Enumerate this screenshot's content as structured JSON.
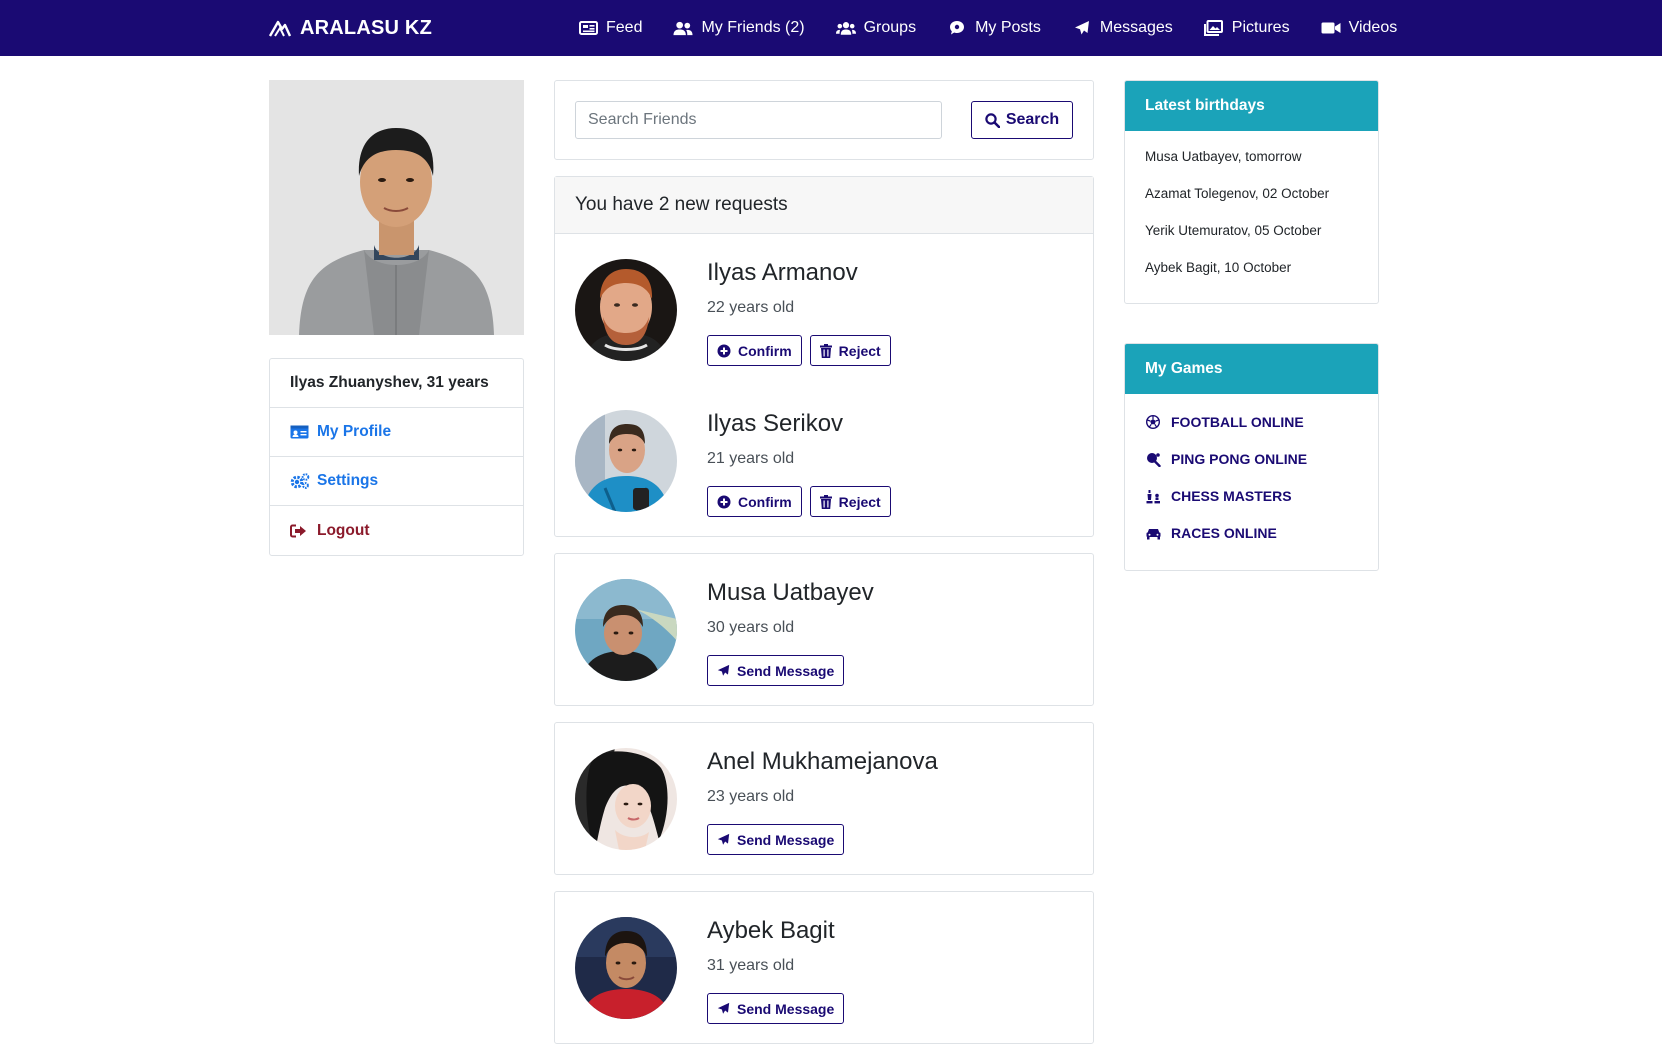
{
  "brand": {
    "name": "ARALASU KZ"
  },
  "nav": [
    {
      "label": "Feed",
      "icon": "newspaper-icon"
    },
    {
      "label": "My Friends (2)",
      "icon": "user-friends-icon"
    },
    {
      "label": "Groups",
      "icon": "users-icon"
    },
    {
      "label": "My Posts",
      "icon": "comment-icon"
    },
    {
      "label": "Messages",
      "icon": "paper-plane-icon"
    },
    {
      "label": "Pictures",
      "icon": "images-icon"
    },
    {
      "label": "Videos",
      "icon": "video-icon"
    }
  ],
  "profile": {
    "name_line": "Ilyas Zhuanyshev, 31 years",
    "links": [
      {
        "label": "My Profile",
        "icon": "id-card-icon"
      },
      {
        "label": "Settings",
        "icon": "cogs-icon"
      },
      {
        "label": "Logout",
        "icon": "sign-out-icon"
      }
    ]
  },
  "search": {
    "placeholder": "Search Friends",
    "value": "",
    "button_label": "Search"
  },
  "requests": {
    "header": "You have 2 new requests",
    "items": [
      {
        "name": "Ilyas Armanov",
        "age": "22 years old",
        "confirm_label": "Confirm",
        "reject_label": "Reject"
      },
      {
        "name": "Ilyas Serikov",
        "age": "21 years old",
        "confirm_label": "Confirm",
        "reject_label": "Reject"
      }
    ]
  },
  "friends": [
    {
      "name": "Musa Uatbayev",
      "age": "30 years old",
      "button_label": "Send Message"
    },
    {
      "name": "Anel Mukhamejanova",
      "age": "23 years old",
      "button_label": "Send Message"
    },
    {
      "name": "Aybek Bagit",
      "age": "31 years old",
      "button_label": "Send Message"
    }
  ],
  "birthdays": {
    "title": "Latest birthdays",
    "items": [
      "Musa Uatbayev, tomorrow",
      "Azamat Tolegenov, 02 October",
      "Yerik Utemuratov, 05 October",
      "Aybek Bagit, 10 October"
    ]
  },
  "games": {
    "title": "My Games",
    "items": [
      {
        "label": "FOOTBALL ONLINE",
        "icon": "futbol-icon"
      },
      {
        "label": "PING PONG ONLINE",
        "icon": "table-tennis-icon"
      },
      {
        "label": "CHESS MASTERS",
        "icon": "chess-icon"
      },
      {
        "label": "RACES ONLINE",
        "icon": "car-icon"
      }
    ]
  },
  "colors": {
    "navbar": "#1a0a73",
    "accent_teal": "#1ba3b9",
    "link_blue": "#1a75e8",
    "logout_red": "#8b1a2b"
  }
}
